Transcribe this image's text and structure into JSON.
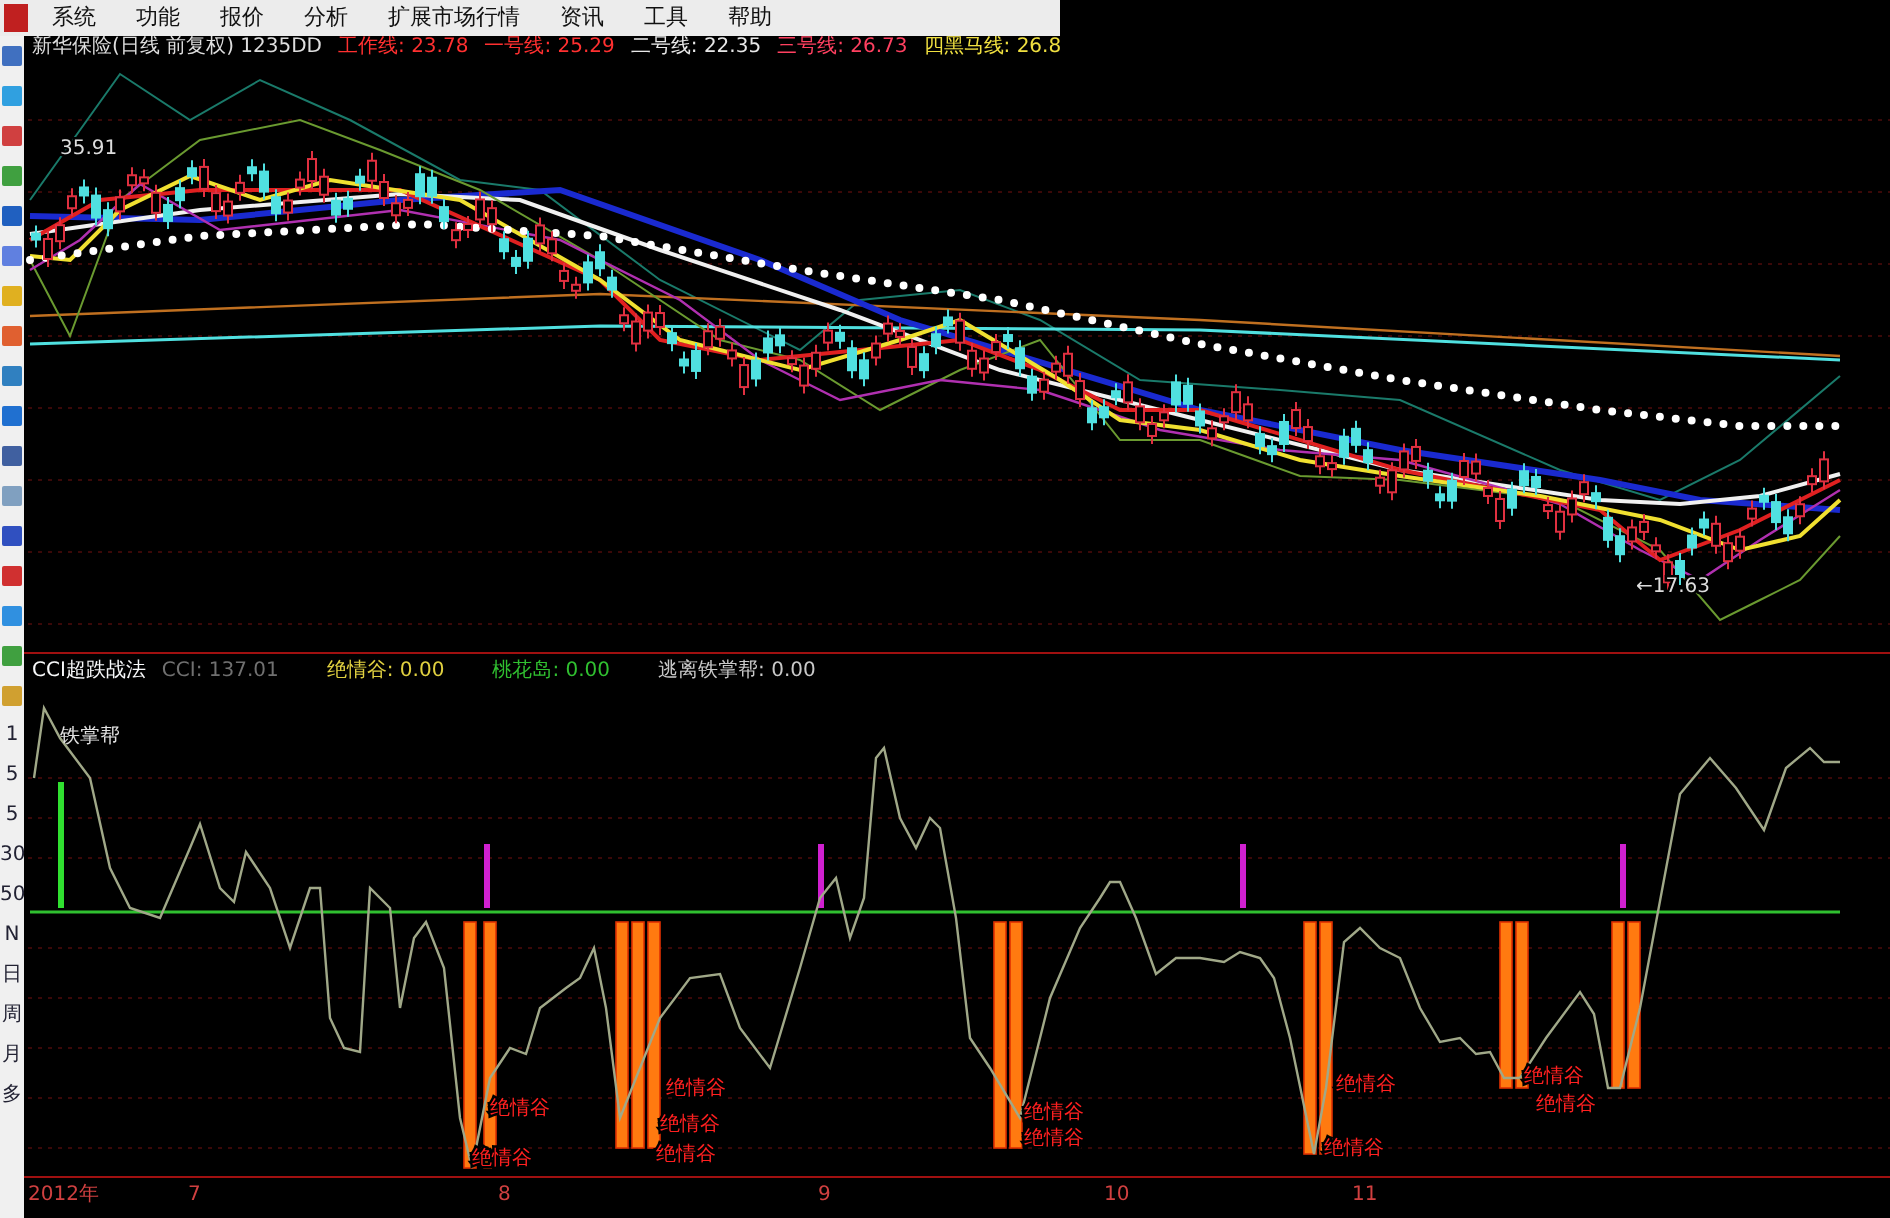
{
  "menu": [
    "系统",
    "功能",
    "报价",
    "分析",
    "扩展市场行情",
    "资讯",
    "工具",
    "帮助"
  ],
  "chart_header": {
    "title": "新华保险(日线 前复权) 1235DD",
    "lines": [
      {
        "label": "工作线: 23.78",
        "color": "#ff3030"
      },
      {
        "label": "一号线: 25.29",
        "color": "#ff3030"
      },
      {
        "label": "二号线: 22.35",
        "color": "#e8e8e8"
      },
      {
        "label": "三号线: 26.73",
        "color": "#ff4060"
      },
      {
        "label": "四黑马线: 26.8",
        "color": "#f0e040"
      }
    ]
  },
  "price_labels": [
    "35.91",
    "←17.63"
  ],
  "indicator": {
    "name": "CCI超跌战法",
    "values": [
      {
        "label": "CCI: 137.01",
        "color": "#707070"
      },
      {
        "label": "绝情谷: 0.00",
        "color": "#e0d040"
      },
      {
        "label": "桃花岛: 0.00",
        "color": "#30c030"
      },
      {
        "label": "逃离铁掌帮: 0.00",
        "color": "#c8c8c8"
      }
    ]
  },
  "indicator_label": "铁掌帮",
  "signal_labels": [
    "绝情谷",
    "绝情谷",
    "绝情谷",
    "绝情谷",
    "绝情谷",
    "绝情谷",
    "绝情谷",
    "绝情谷",
    "绝情谷",
    "绝情谷",
    "绝情谷"
  ],
  "axis_labels": [
    "1",
    "5",
    "5",
    "30",
    "50",
    "N"
  ],
  "period_buttons": [
    "日",
    "周",
    "月",
    "多"
  ],
  "x_axis": [
    "2012年",
    "7",
    "8",
    "9",
    "10",
    "11"
  ]
}
